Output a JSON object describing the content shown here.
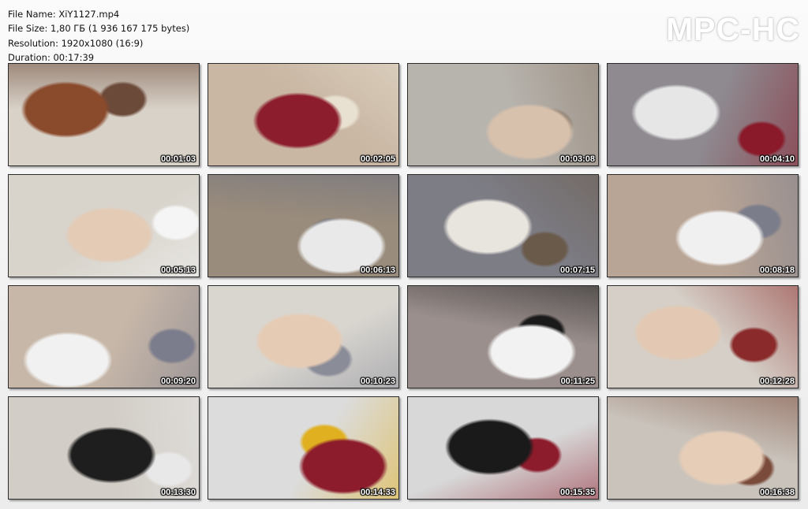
{
  "header": {
    "file_name": "File Name: XiY1127.mp4",
    "file_size": "File Size: 1,80 ГБ (1 936 167 175 bytes)",
    "resolution": "Resolution: 1920x1080 (16:9)",
    "duration": "Duration: 00:17:39"
  },
  "logo": "MPC-HC",
  "thumbnails": [
    {
      "time": "00:01:03",
      "palette": [
        "#d9d2c8",
        "#8a4a2c",
        "#6b4a3a"
      ]
    },
    {
      "time": "00:02:05",
      "palette": [
        "#c9b6a3",
        "#8c1d2c",
        "#e8e0d0"
      ]
    },
    {
      "time": "00:03:08",
      "palette": [
        "#b7b3ad",
        "#d7c1ad",
        "#8a7a6a"
      ]
    },
    {
      "time": "00:04:10",
      "palette": [
        "#8e8a90",
        "#e6e6e6",
        "#8a1a2a"
      ]
    },
    {
      "time": "00:05:13",
      "palette": [
        "#d8d4cc",
        "#e3cbb6",
        "#f5f5f5"
      ]
    },
    {
      "time": "00:06:13",
      "palette": [
        "#9a8c7c",
        "#e9e9e9",
        "#6b7080"
      ]
    },
    {
      "time": "00:07:15",
      "palette": [
        "#7d7d86",
        "#e8e4de",
        "#6a5a4a"
      ]
    },
    {
      "time": "00:08:18",
      "palette": [
        "#b9a596",
        "#f0f0f0",
        "#7c7d8a"
      ]
    },
    {
      "time": "00:09:20",
      "palette": [
        "#c7b7a8",
        "#f1f1f1",
        "#7c7d8c"
      ]
    },
    {
      "time": "00:10:23",
      "palette": [
        "#d9d6d0",
        "#e6cbb4",
        "#8a8c98"
      ]
    },
    {
      "time": "00:11:25",
      "palette": [
        "#9a8f8c",
        "#f2f2f2",
        "#1a1a1a"
      ]
    },
    {
      "time": "00:12:28",
      "palette": [
        "#d5cfc7",
        "#e3c9b3",
        "#8a2a2a"
      ]
    },
    {
      "time": "00:13:30",
      "palette": [
        "#d2cdc6",
        "#1e1e1e",
        "#e8e8e8"
      ]
    },
    {
      "time": "00:14:33",
      "palette": [
        "#dcdcdc",
        "#8c1c2c",
        "#e0b020"
      ]
    },
    {
      "time": "00:15:35",
      "palette": [
        "#d8d8d8",
        "#1a1a1a",
        "#8c1c2c"
      ]
    },
    {
      "time": "00:16:38",
      "palette": [
        "#c9c3bb",
        "#e6cdb8",
        "#7a4a3a"
      ]
    }
  ]
}
